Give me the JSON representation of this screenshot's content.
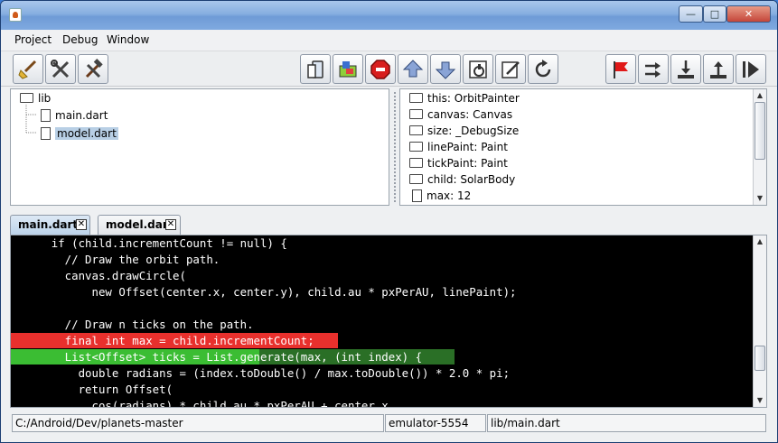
{
  "menu": [
    "Project",
    "Debug",
    "Window"
  ],
  "window_controls": {
    "minimize": "—",
    "maximize": "□",
    "close": "✕"
  },
  "toolbar_icons": [
    "broom-icon",
    "tools-icon",
    "hammer-wrench-icon",
    "device-icon",
    "android-icon",
    "stop-icon",
    "step-up-icon",
    "step-down-icon",
    "coverage-icon",
    "edit-icon",
    "reload-icon",
    "flag-icon",
    "step-over-icon",
    "step-into-icon",
    "step-out-icon",
    "resume-icon"
  ],
  "tree": {
    "root": "lib",
    "files": [
      "main.dart",
      "model.dart"
    ],
    "selected": "model.dart"
  },
  "variables": [
    {
      "icon": "folder",
      "text": "this:  OrbitPainter"
    },
    {
      "icon": "folder",
      "text": "canvas:  Canvas"
    },
    {
      "icon": "folder",
      "text": "size:  _DebugSize"
    },
    {
      "icon": "folder",
      "text": "linePaint:  Paint"
    },
    {
      "icon": "folder",
      "text": "tickPaint:  Paint"
    },
    {
      "icon": "folder",
      "text": "child:  SolarBody"
    },
    {
      "icon": "file",
      "text": "max:  12"
    }
  ],
  "tabs": [
    {
      "label": "main.dart",
      "active": true
    },
    {
      "label": "model.dart",
      "active": false
    }
  ],
  "code": [
    "      if (child.incrementCount != null) {",
    "        // Draw the orbit path.",
    "        canvas.drawCircle(",
    "            new Offset(center.x, center.y), child.au * pxPerAU, linePaint);",
    "",
    "        // Draw n ticks on the path.",
    "        final int max = child.incrementCount;",
    "        List<Offset> ticks = List.generate(max, (int index) {",
    "          double radians = (index.toDouble() / max.toDouble()) * 2.0 * pi;",
    "          return Offset(",
    "            cos(radians) * child.au * pxPerAU + center.x,"
  ],
  "highlight": {
    "breakpoint_line": 7,
    "current_line": 8
  },
  "status": {
    "path": "C:/Android/Dev/planets-master",
    "device": "emulator-5554",
    "file": "lib/main.dart"
  },
  "colors": {
    "breakpoint": "#e8302d",
    "current_line": "#3bbd33",
    "editor_bg": "#000000"
  }
}
